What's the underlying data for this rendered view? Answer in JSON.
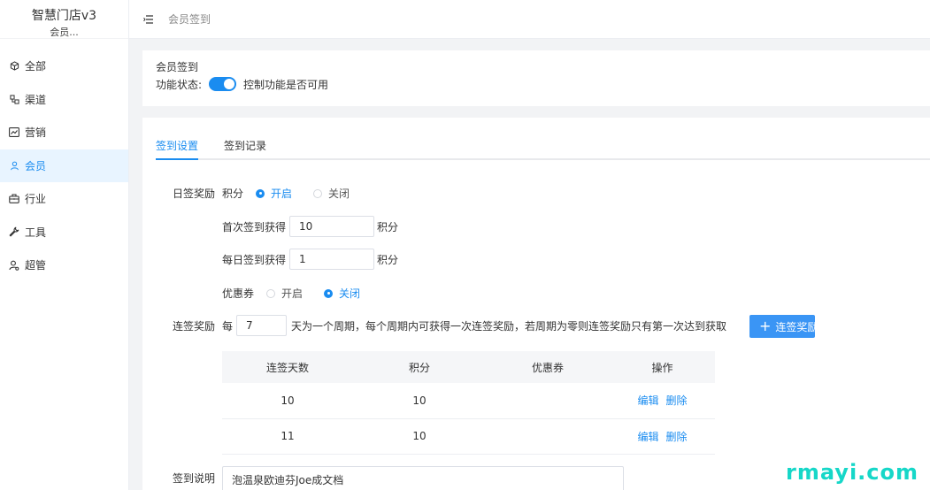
{
  "brand": {
    "title": "智慧门店v3",
    "subtitle": "会员..."
  },
  "nav": {
    "items": [
      {
        "label": "全部",
        "icon": "cube-icon"
      },
      {
        "label": "渠道",
        "icon": "channel-icon"
      },
      {
        "label": "营销",
        "icon": "chart-line-icon"
      },
      {
        "label": "会员",
        "icon": "user-icon",
        "active": true
      },
      {
        "label": "行业",
        "icon": "briefcase-icon"
      },
      {
        "label": "工具",
        "icon": "wrench-icon"
      },
      {
        "label": "超管",
        "icon": "admin-icon"
      }
    ]
  },
  "topbar": {
    "breadcrumb": "会员签到",
    "menu_icon": "menu-fold-icon"
  },
  "status_card": {
    "title": "会员签到",
    "status_label": "功能状态:",
    "toggle_on": true,
    "hint": "控制功能是否可用"
  },
  "tabs": [
    {
      "label": "签到设置",
      "active": true
    },
    {
      "label": "签到记录",
      "active": false
    }
  ],
  "daily": {
    "label": "日签奖励",
    "points_label": "积分",
    "radio_on": "开启",
    "radio_off": "关闭",
    "points_enabled": true,
    "first_label": "首次签到获得",
    "first_value": "10",
    "first_unit": "积分",
    "daily_label": "每日签到获得",
    "daily_value": "1",
    "daily_unit": "积分",
    "coupon_label": "优惠券",
    "coupon_on": "开启",
    "coupon_off": "关闭",
    "coupon_enabled": false
  },
  "streak": {
    "label": "连签奖励",
    "prefix": "每",
    "cycle_value": "7",
    "description": "天为一个周期，每个周期内可获得一次连签奖励，若周期为零则连签奖励只有第一次达到获取",
    "add_button": "连签奖励",
    "columns": [
      "连签天数",
      "积分",
      "优惠券",
      "操作"
    ],
    "rows": [
      {
        "days": "10",
        "points": "10",
        "coupon": "",
        "edit": "编辑",
        "delete": "删除"
      },
      {
        "days": "11",
        "points": "10",
        "coupon": "",
        "edit": "编辑",
        "delete": "删除"
      }
    ]
  },
  "explain": {
    "label": "签到说明",
    "value": "泡温泉欧迪芬Joe成文档"
  },
  "watermark": "rmayi.com",
  "colors": {
    "accent": "#1a8cf0",
    "button": "#3a95f5",
    "active_bg": "#e8f4ff",
    "watermark": "#16d7c8"
  }
}
